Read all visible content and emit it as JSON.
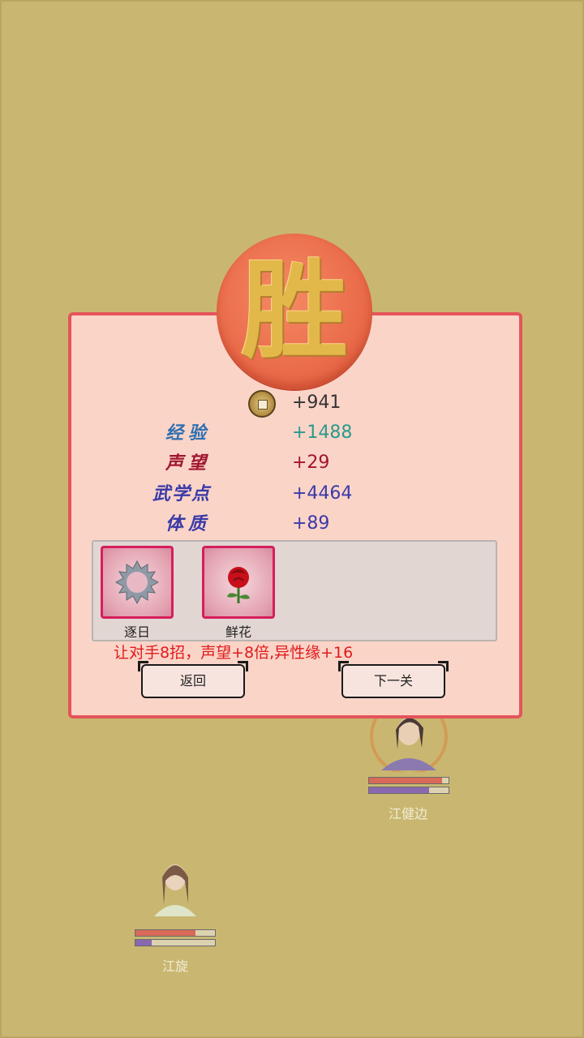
{
  "result": {
    "seal_char": "胜"
  },
  "rewards": [
    {
      "icon": "coin-icon",
      "label": "",
      "value": "+941",
      "color": "#333333"
    },
    {
      "label": "经验",
      "value": "+1488",
      "color": "#2a9a8c"
    },
    {
      "label": "声望",
      "value": "+29",
      "color": "#a0162e"
    },
    {
      "label": "武学点",
      "value": "+4464",
      "color": "#3a3aa8"
    },
    {
      "label": "体质",
      "value": "+89",
      "color": "#3a3aa8"
    }
  ],
  "items": [
    {
      "name": "逐日",
      "icon": "saw-blade-icon"
    },
    {
      "name": "鲜花",
      "icon": "rose-icon"
    }
  ],
  "bonus_text": "让对手8招，声望+8倍,异性缘+16",
  "buttons": {
    "back": "返回",
    "next": "下一关"
  },
  "characters": [
    {
      "name": "江健边",
      "hp": 0.92,
      "mp": 0.76
    },
    {
      "name": "江旋",
      "hp": 0.76,
      "mp": 0.2
    }
  ]
}
